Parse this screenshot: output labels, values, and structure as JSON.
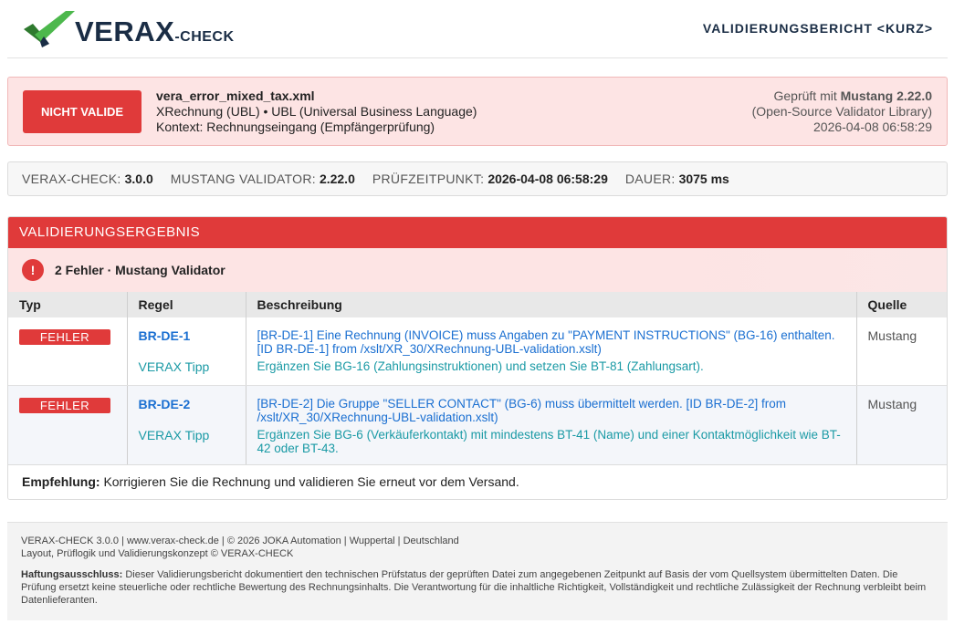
{
  "header": {
    "logo_word": "VERAX",
    "logo_suffix": "-CHECK",
    "title": "VALIDIERUNGSBERICHT <KURZ>"
  },
  "status": {
    "badge": "NICHT VALIDE",
    "file_name": "vera_error_mixed_tax.xml",
    "format": "XRechnung (UBL) • UBL (Universal Business Language)",
    "context": "Kontext: Rechnungseingang (Empfängerprüfung)",
    "checked_with_prefix": "Geprüft mit",
    "checked_with_tool": "Mustang 2.22.0",
    "library": "(Open-Source Validator Library)",
    "timestamp": "2026-04-08 06:58:29"
  },
  "meta": {
    "items": [
      {
        "label": "VERAX-CHECK:",
        "value": "3.0.0"
      },
      {
        "label": "MUSTANG VALIDATOR:",
        "value": "2.22.0"
      },
      {
        "label": "PRÜFZEITPUNKT:",
        "value": "2026-04-08 06:58:29"
      },
      {
        "label": "DAUER:",
        "value": "3075 ms"
      }
    ]
  },
  "result": {
    "section_title": "VALIDIERUNGSERGEBNIS",
    "summary": "2 Fehler · Mustang Validator",
    "columns": [
      "Typ",
      "Regel",
      "Beschreibung",
      "Quelle"
    ],
    "rows": [
      {
        "type": "FEHLER",
        "rule": "BR-DE-1",
        "tip_label": "VERAX Tipp",
        "description": "[BR-DE-1] Eine Rechnung (INVOICE) muss Angaben zu \"PAYMENT INSTRUCTIONS\" (BG-16) enthalten. [ID BR-DE-1] from /xslt/XR_30/XRechnung-UBL-validation.xslt)",
        "tip": "Ergänzen Sie BG-16 (Zahlungsinstruktionen) und setzen Sie BT-81 (Zahlungsart).",
        "source": "Mustang"
      },
      {
        "type": "FEHLER",
        "rule": "BR-DE-2",
        "tip_label": "VERAX Tipp",
        "description": "[BR-DE-2] Die Gruppe \"SELLER CONTACT\" (BG-6) muss übermittelt werden. [ID BR-DE-2] from /xslt/XR_30/XRechnung-UBL-validation.xslt)",
        "tip": "Ergänzen Sie BG-6 (Verkäuferkontakt) mit mindestens BT-41 (Name) und einer Kontaktmöglichkeit wie BT-42 oder BT-43.",
        "source": "Mustang"
      }
    ],
    "recommendation_label": "Empfehlung:",
    "recommendation_text": "Korrigieren Sie die Rechnung und validieren Sie erneut vor dem Versand."
  },
  "footer": {
    "line1_prefix": "VERAX-CHECK 3.0.0 |",
    "line1_link": "www.verax-check.de",
    "line1_suffix": "| © 2026 JOKA Automation | Wuppertal | Deutschland",
    "line2": "Layout, Prüflogik und Validierungskonzept © VERAX-CHECK",
    "disclaimer_label": "Haftungsausschluss:",
    "disclaimer_text": "Dieser Validierungsbericht dokumentiert den technischen Prüfstatus der geprüften Datei zum angegebenen Zeitpunkt auf Basis der vom Quellsystem übermittelten Daten. Die Prüfung ersetzt keine steuerliche oder rechtliche Bewertung des Rechnungsinhalts. Die Verantwortung für die inhaltliche Richtigkeit, Vollständigkeit und rechtliche Zulässigkeit der Rechnung verbleibt beim Datenlieferanten."
  },
  "colors": {
    "error_red": "#e03a3a",
    "error_bg": "#fde4e4",
    "brand_navy": "#1a2d45",
    "link_blue": "#1a6fd1",
    "tip_teal": "#1a9aa5",
    "logo_green": "#3aa53a"
  }
}
